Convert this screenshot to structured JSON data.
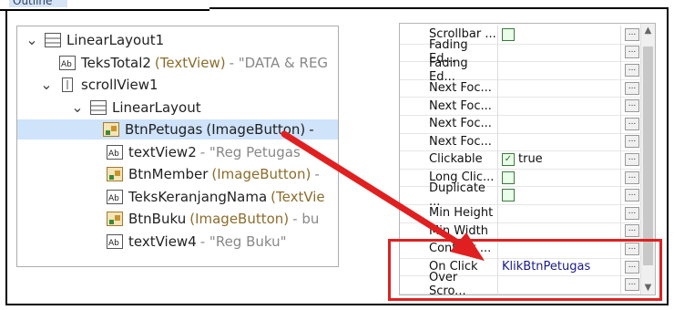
{
  "window": {
    "tab_label": "Outline"
  },
  "outline": {
    "items": [
      {
        "name": "LinearLayout1",
        "type": "",
        "desc": "",
        "icon": "linear-layout-icon",
        "indent": 1,
        "chevron": "v"
      },
      {
        "name": "TeksTotal2",
        "type": "(TextView)",
        "desc": "- \"DATA & REG",
        "icon": "textview-icon",
        "indent": 2,
        "chevron": ""
      },
      {
        "name": "scrollView1",
        "type": "",
        "desc": "",
        "icon": "scrollview-icon",
        "indent": 2,
        "chevron": "v"
      },
      {
        "name": "LinearLayout",
        "type": "",
        "desc": "",
        "icon": "linear-layout-icon",
        "indent": 3,
        "chevron": "v"
      },
      {
        "name": "BtnPetugas",
        "type": "(ImageButton)",
        "desc": "-",
        "icon": "imagebutton-icon",
        "indent": 4,
        "chevron": ""
      },
      {
        "name": "textView2",
        "type": "",
        "desc": "- \"Reg Petugas",
        "icon": "textview-icon",
        "indent": 4,
        "chevron": ""
      },
      {
        "name": "BtnMember",
        "type": "(ImageButton)",
        "desc": "-",
        "icon": "imagebutton-icon",
        "indent": 4,
        "chevron": ""
      },
      {
        "name": "TeksKeranjangNama",
        "type": "(TextVie",
        "desc": "",
        "icon": "textview-icon",
        "indent": 4,
        "chevron": ""
      },
      {
        "name": "BtnBuku",
        "type": "(ImageButton)",
        "desc": "- bu",
        "icon": "imagebutton-icon",
        "indent": 4,
        "chevron": ""
      },
      {
        "name": "textView4",
        "type": "",
        "desc": "- \"Reg Buku\"",
        "icon": "textview-icon",
        "indent": 4,
        "chevron": ""
      }
    ]
  },
  "properties": {
    "rows": [
      {
        "name": "Scrollbar ...",
        "value": "",
        "checkbox": "empty"
      },
      {
        "name": "Fading Ed...",
        "value": "",
        "checkbox": ""
      },
      {
        "name": "Fading Ed...",
        "value": "",
        "checkbox": ""
      },
      {
        "name": "Next Foc...",
        "value": "",
        "checkbox": ""
      },
      {
        "name": "Next Foc...",
        "value": "",
        "checkbox": ""
      },
      {
        "name": "Next Foc...",
        "value": "",
        "checkbox": ""
      },
      {
        "name": "Next Foc...",
        "value": "",
        "checkbox": ""
      },
      {
        "name": "Clickable",
        "value": "true",
        "checkbox": "checked"
      },
      {
        "name": "Long Clic...",
        "value": "",
        "checkbox": "empty"
      },
      {
        "name": "Duplicate ...",
        "value": "",
        "checkbox": "empty"
      },
      {
        "name": "Min Height",
        "value": "",
        "checkbox": ""
      },
      {
        "name": "Min Width",
        "value": "",
        "checkbox": ""
      },
      {
        "name": "Content ...",
        "value": "",
        "checkbox": ""
      },
      {
        "name": "On Click",
        "value": "KlikBtnPetugas",
        "checkbox": ""
      },
      {
        "name": "Over Scro...",
        "value": "",
        "checkbox": ""
      }
    ],
    "ellipsis_label": "...",
    "scroll_up": "▲",
    "scroll_down": "▼"
  },
  "colors": {
    "highlight": "#e02020",
    "selection": "#cfe3fb"
  }
}
